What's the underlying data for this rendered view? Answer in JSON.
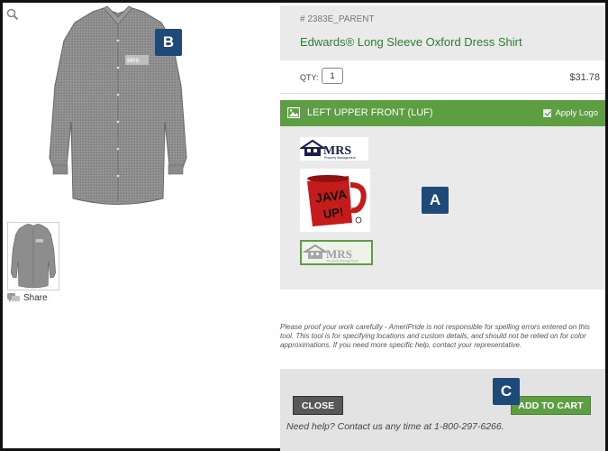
{
  "product": {
    "sku": "# 2383E_PARENT",
    "title": "Edwards® Long Sleeve Oxford Dress Shirt",
    "qty_label": "QTY:",
    "qty_value": "1",
    "price": "$31.78"
  },
  "left": {
    "share_label": "Share"
  },
  "location": {
    "label": "LEFT UPPER FRONT (LUF)",
    "apply_logo_label": "Apply Logo"
  },
  "logos": {
    "mrs_text": "MRS",
    "mrs_sub": "Property Management",
    "java_text": "JAVA",
    "java_up": "UP!"
  },
  "disclaimer": "Please proof your work carefully - AmeriPride is not responsible for spelling errors entered on this tool. This tool is for specifying locations and custom details, and should not be relied on for color approximations. If you need more specific help, contact your representative.",
  "actions": {
    "close_label": "CLOSE",
    "add_to_cart_label": "ADD TO CART",
    "help_text": "Need help? Contact us any time at 1-800-297-6266."
  },
  "annotations": {
    "a": "A",
    "b": "B",
    "c": "C"
  },
  "colors": {
    "green": "#5c9e41",
    "title_green": "#2e7d2e",
    "badge_blue": "#1e4a7a"
  }
}
